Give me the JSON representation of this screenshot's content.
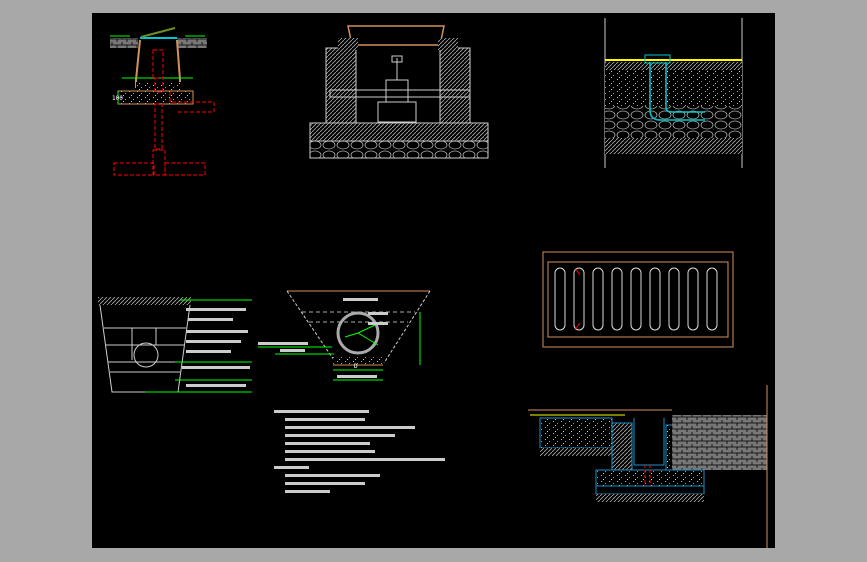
{
  "viewer": {
    "background_color": "#a8a8a8",
    "canvas_color": "#000000"
  },
  "drawing": {
    "colors": {
      "outline": "#c8c8c8",
      "dimension": "#00ff00",
      "pipe_dashed": "#ff0000",
      "frame": "#d2915a",
      "water": "#00c8d2",
      "section_lines": "#1e90c8",
      "surface": "#ffff00"
    },
    "labels": {
      "pipe_diameter": "D",
      "dimension_100": "100"
    }
  }
}
